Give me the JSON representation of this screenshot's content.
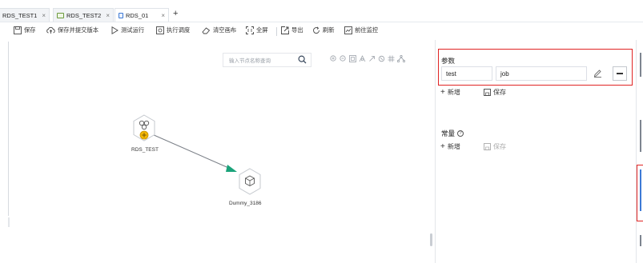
{
  "tabs": [
    {
      "label": "RDS_TEST1",
      "close": "×",
      "icon": "none"
    },
    {
      "label": "RDS_TEST2",
      "close": "×",
      "icon": "db-icon"
    },
    {
      "label": "RDS_01",
      "close": "×",
      "icon": "job-icon"
    }
  ],
  "tab_add": "+",
  "toolbar": {
    "save": "保存",
    "save_submit": "保存并提交版本",
    "test_run": "测试运行",
    "schedule": "执行调度",
    "clear": "清空画布",
    "fullscreen": "全屏",
    "export": "导出",
    "refresh": "刷新",
    "monitor": "前往监控"
  },
  "canvas": {
    "search_placeholder": "输入节点名称查询",
    "nodes": [
      {
        "label": "RDS_TEST",
        "icon": "rds-node-icon"
      },
      {
        "label": "Dummy_3186",
        "icon": "dummy-node-icon"
      }
    ]
  },
  "panel": {
    "params_title": "参数",
    "param_name": "test",
    "param_value": "job",
    "add_label": "新增",
    "save_label": "保存",
    "const_title": "常量",
    "const_help": "?",
    "const_add_label": "新增",
    "const_save_label": "保存"
  },
  "colors": {
    "accent": "#3d7ad6",
    "highlight_border": "#e02424",
    "node_badge": "#f2b705",
    "edge": "#7a7f87",
    "edge_arrow": "#1aa37a"
  }
}
